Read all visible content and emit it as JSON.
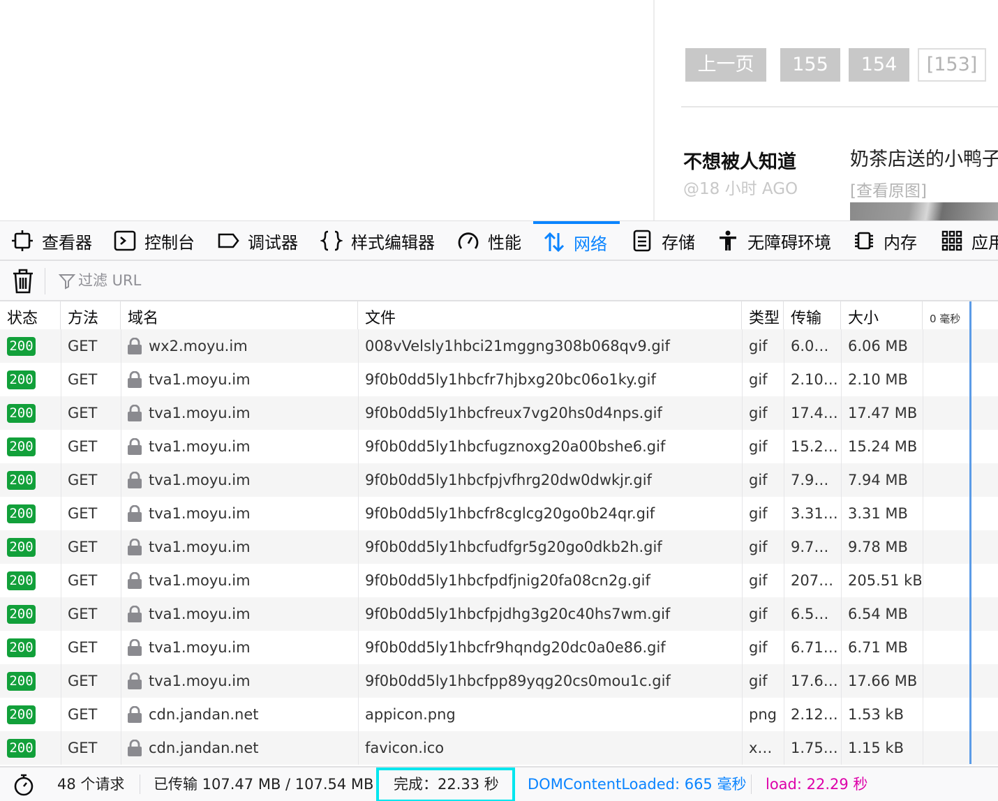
{
  "page": {
    "pagination": {
      "prev": "上一页",
      "p155": "155",
      "p154": "154",
      "p153": "[153]"
    },
    "post": {
      "author": "不想被人知道",
      "time": "@18 小时 AGO",
      "text": "奶茶店送的小鸭子",
      "link": "[查看原图]"
    }
  },
  "devtools": {
    "tabs": [
      {
        "label": "查看器",
        "icon": "inspector-icon"
      },
      {
        "label": "控制台",
        "icon": "console-icon"
      },
      {
        "label": "调试器",
        "icon": "debugger-icon"
      },
      {
        "label": "样式编辑器",
        "icon": "style-editor-icon"
      },
      {
        "label": "性能",
        "icon": "performance-icon"
      },
      {
        "label": "网络",
        "icon": "network-icon",
        "active": true
      },
      {
        "label": "存储",
        "icon": "storage-icon"
      },
      {
        "label": "无障碍环境",
        "icon": "accessibility-icon"
      },
      {
        "label": "内存",
        "icon": "memory-icon"
      },
      {
        "label": "应用",
        "icon": "application-icon"
      }
    ],
    "filter": {
      "placeholder": "过滤 URL"
    },
    "columns": {
      "status": "状态",
      "method": "方法",
      "domain": "域名",
      "file": "文件",
      "type": "类型",
      "transferred": "传输",
      "size": "大小",
      "timeline": "0 毫秒"
    },
    "requests": [
      {
        "status": "200",
        "method": "GET",
        "domain": "wx2.moyu.im",
        "file": "008vVelsly1hbci21mggng308b068qv9.gif",
        "type": "gif",
        "transferred": "6.0…",
        "size": "6.06 MB"
      },
      {
        "status": "200",
        "method": "GET",
        "domain": "tva1.moyu.im",
        "file": "9f0b0dd5ly1hbcfr7hjbxg20bc06o1ky.gif",
        "type": "gif",
        "transferred": "2.10…",
        "size": "2.10 MB"
      },
      {
        "status": "200",
        "method": "GET",
        "domain": "tva1.moyu.im",
        "file": "9f0b0dd5ly1hbcfreux7vg20hs0d4nps.gif",
        "type": "gif",
        "transferred": "17.4…",
        "size": "17.47 MB"
      },
      {
        "status": "200",
        "method": "GET",
        "domain": "tva1.moyu.im",
        "file": "9f0b0dd5ly1hbcfugznoxg20a00bshe6.gif",
        "type": "gif",
        "transferred": "15.2…",
        "size": "15.24 MB"
      },
      {
        "status": "200",
        "method": "GET",
        "domain": "tva1.moyu.im",
        "file": "9f0b0dd5ly1hbcfpjvfhrg20dw0dwkjr.gif",
        "type": "gif",
        "transferred": "7.9…",
        "size": "7.94 MB"
      },
      {
        "status": "200",
        "method": "GET",
        "domain": "tva1.moyu.im",
        "file": "9f0b0dd5ly1hbcfr8cglcg20go0b24qr.gif",
        "type": "gif",
        "transferred": "3.31…",
        "size": "3.31 MB"
      },
      {
        "status": "200",
        "method": "GET",
        "domain": "tva1.moyu.im",
        "file": "9f0b0dd5ly1hbcfudfgr5g20go0dkb2h.gif",
        "type": "gif",
        "transferred": "9.7…",
        "size": "9.78 MB"
      },
      {
        "status": "200",
        "method": "GET",
        "domain": "tva1.moyu.im",
        "file": "9f0b0dd5ly1hbcfpdfjnig20fa08cn2g.gif",
        "type": "gif",
        "transferred": "207…",
        "size": "205.51 kB"
      },
      {
        "status": "200",
        "method": "GET",
        "domain": "tva1.moyu.im",
        "file": "9f0b0dd5ly1hbcfpjdhg3g20c40hs7wm.gif",
        "type": "gif",
        "transferred": "6.5…",
        "size": "6.54 MB"
      },
      {
        "status": "200",
        "method": "GET",
        "domain": "tva1.moyu.im",
        "file": "9f0b0dd5ly1hbcfr9hqndg20dc0a0e86.gif",
        "type": "gif",
        "transferred": "6.71…",
        "size": "6.71 MB"
      },
      {
        "status": "200",
        "method": "GET",
        "domain": "tva1.moyu.im",
        "file": "9f0b0dd5ly1hbcfpp89yqg20cs0mou1c.gif",
        "type": "gif",
        "transferred": "17.6…",
        "size": "17.66 MB"
      },
      {
        "status": "200",
        "method": "GET",
        "domain": "cdn.jandan.net",
        "file": "appicon.png",
        "type": "png",
        "transferred": "2.12…",
        "size": "1.53 kB"
      },
      {
        "status": "200",
        "method": "GET",
        "domain": "cdn.jandan.net",
        "file": "favicon.ico",
        "type": "x…",
        "transferred": "1.75…",
        "size": "1.15 kB"
      }
    ],
    "status_bar": {
      "requests": "48 个请求",
      "transferred": "已传输 107.47 MB / 107.54 MB",
      "finish": "完成：22.33 秒",
      "dom_content_loaded": "DOMContentLoaded: 665 毫秒",
      "load": "load: 22.29 秒",
      "colors": {
        "dcl": "#0a84ff",
        "load": "#dd00a9",
        "status_ok": "#12a03a",
        "accent": "#0a84ff"
      }
    }
  }
}
